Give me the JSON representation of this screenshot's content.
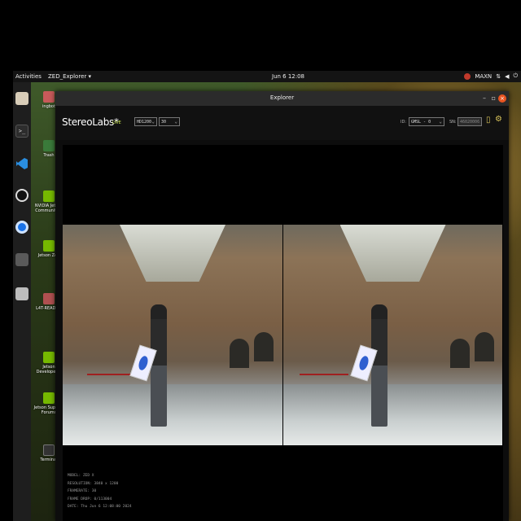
{
  "topbar": {
    "activities": "Activities",
    "app_menu": "ZED_Explorer ▾",
    "clock": "Jun 6  12:08",
    "power_mode": "MAXN",
    "tray_icons": [
      "nvidia-icon",
      "network-icon",
      "volume-icon",
      "power-icon"
    ]
  },
  "dock": {
    "items": [
      "files-icon",
      "terminal-icon",
      "vscode-icon",
      "obs-icon",
      "chromium-icon",
      "app-icon",
      "disk-icon"
    ]
  },
  "desktop": {
    "items": [
      {
        "label": "ingbot"
      },
      {
        "label": "Trash"
      },
      {
        "label": "NVIDIA Jetson Community P"
      },
      {
        "label": "Jetson Zoo"
      },
      {
        "label": "L4T-README"
      },
      {
        "label": "Jetson Developer Z"
      },
      {
        "label": "Jetson Support Forums"
      },
      {
        "label": "Terminal"
      }
    ]
  },
  "window": {
    "title": "Explorer",
    "brand": "StereoLabs*",
    "live": "LIVE",
    "resolution_select": "HD1200",
    "fps_select": "30",
    "id_label": "ID:",
    "id_select": "GMSL - 0",
    "sn_label": "SN:",
    "sn_value": "46020006",
    "accent": "#d9c45a"
  },
  "info": {
    "model": "MODEL: ZED X",
    "resolution": "RESOLUTION: 3840 x 1200",
    "framerate": "FRAMERATE: 30",
    "frame_drop": "FRAME DROP: 0/113004",
    "date": "DATE: Thu Jun 6 12:08:00 2024"
  }
}
